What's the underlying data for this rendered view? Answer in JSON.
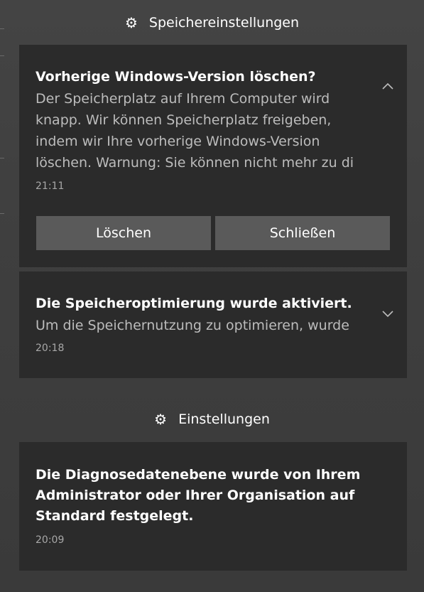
{
  "group_storage": {
    "title": "Speichereinstellungen",
    "icon": "gear-icon"
  },
  "notification_1": {
    "title": "Vorherige Windows-Version löschen?",
    "body_lines": [
      "Der Speicherplatz auf Ihrem Computer wird",
      "knapp. Wir können Speicherplatz freigeben,",
      "indem wir Ihre vorherige Windows-Version",
      "löschen. Warnung: Sie können nicht mehr zu di"
    ],
    "time": "21:11",
    "collapse_icon": "chevron-up-icon",
    "delete_label": "Löschen",
    "close_label": "Schließen"
  },
  "notification_2": {
    "title": "Die Speicheroptimierung wurde aktiviert.",
    "body": "Um die Speichernutzung zu optimieren, wurde",
    "time": "20:18",
    "expand_icon": "chevron-down-icon"
  },
  "group_settings": {
    "title": "Einstellungen",
    "icon": "gear-icon"
  },
  "notification_3": {
    "title_lines": [
      "Die Diagnosedatenebene wurde von Ihrem",
      "Administrator oder Ihrer Organisation auf",
      "Standard festgelegt."
    ],
    "time": "20:09"
  }
}
